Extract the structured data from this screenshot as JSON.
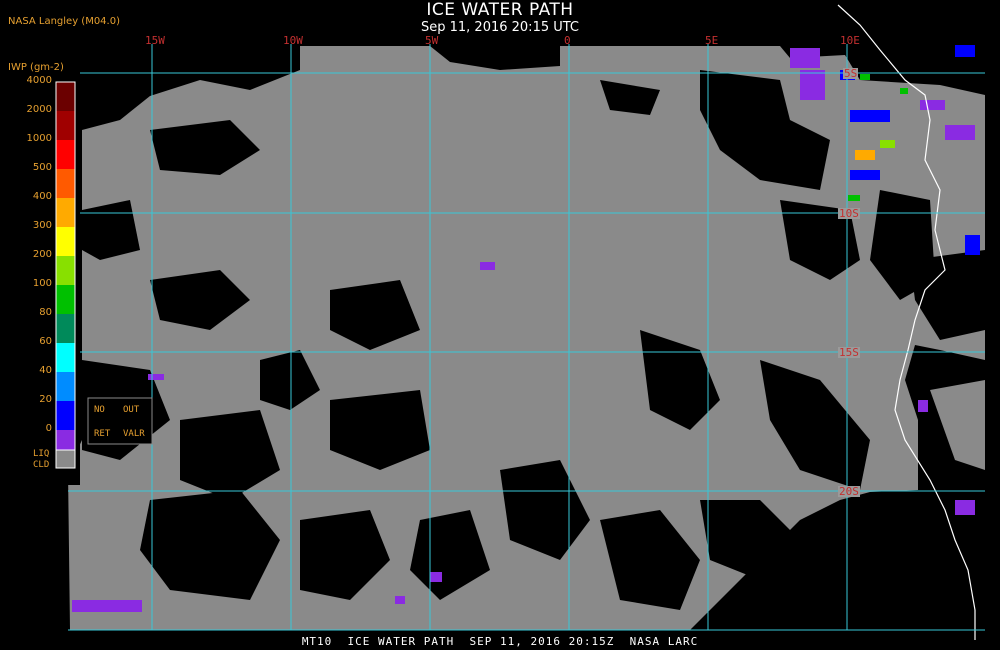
{
  "title": "ICE WATER PATH",
  "subtitle": "Sep 11, 2016 20:15 UTC",
  "producer": "NASA Langley (M04.0)",
  "footer": "MT10  ICE WATER PATH  SEP 11, 2016 20:15Z  NASA LARC",
  "map": {
    "lon_labels": [
      "15W",
      "10W",
      "5W",
      "0",
      "5E",
      "10E"
    ],
    "lat_labels": [
      "5S",
      "10S",
      "15S",
      "20S"
    ],
    "colors": {
      "land_cloud_free": "#000000",
      "liquid_cloud": "#8a8a8a",
      "gridline": "#38c8d8",
      "coastline": "#ffffff",
      "label": "#c43030"
    }
  },
  "colorbar": {
    "unit_label": "IWP (gm-2)",
    "levels": [
      {
        "label": "4000",
        "color": "#6b0000"
      },
      {
        "label": "2000",
        "color": "#a00000"
      },
      {
        "label": "1000",
        "color": "#ff0000"
      },
      {
        "label": "500",
        "color": "#ff5a00"
      },
      {
        "label": "400",
        "color": "#ffaa00"
      },
      {
        "label": "300",
        "color": "#ffff00"
      },
      {
        "label": "200",
        "color": "#88e000"
      },
      {
        "label": "100",
        "color": "#00c000"
      },
      {
        "label": "80",
        "color": "#008a5a"
      },
      {
        "label": "60",
        "color": "#00ffff"
      },
      {
        "label": "40",
        "color": "#008cff"
      },
      {
        "label": "20",
        "color": "#0000ff"
      },
      {
        "label": "0",
        "color": "#8a2be2"
      }
    ],
    "no_ret_label_1": "NO",
    "no_ret_label_2": "RET",
    "out_valr_label_1": "OUT",
    "out_valr_label_2": "VALR",
    "liq_cld_label_1": "LIQ",
    "liq_cld_label_2": "CLD"
  }
}
